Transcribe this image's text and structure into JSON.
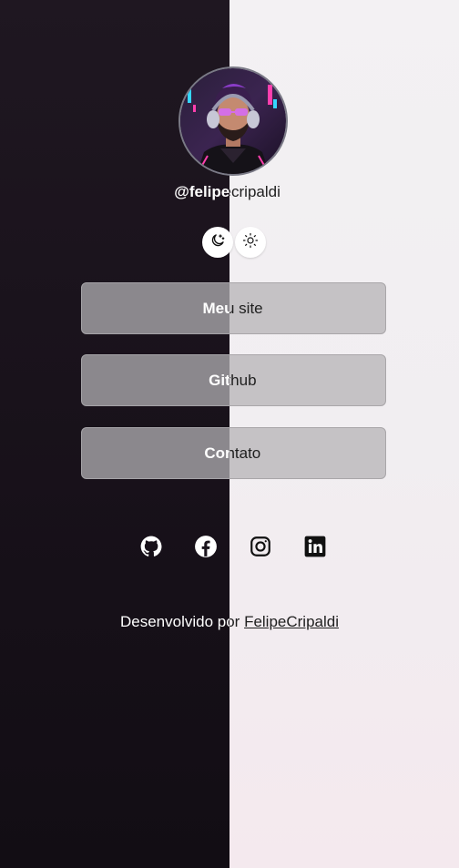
{
  "profile": {
    "username": "@felipecripaldi",
    "avatar_alt": "Felipe Cripaldi avatar"
  },
  "theme_toggle": {
    "dark_icon": "moon-icon",
    "light_icon": "sun-icon"
  },
  "links": [
    {
      "label": "Meu site"
    },
    {
      "label": "Github"
    },
    {
      "label": "Contato"
    }
  ],
  "social": [
    {
      "name": "github-icon"
    },
    {
      "name": "facebook-icon"
    },
    {
      "name": "instagram-icon"
    },
    {
      "name": "linkedin-icon"
    }
  ],
  "footer": {
    "prefix": "Desenvolvido por ",
    "author": "FelipeCripaldi"
  },
  "colors": {
    "dark_bg": "#19121b",
    "light_bg": "#f1eef1",
    "avatar_accent": "#e24fd0"
  }
}
